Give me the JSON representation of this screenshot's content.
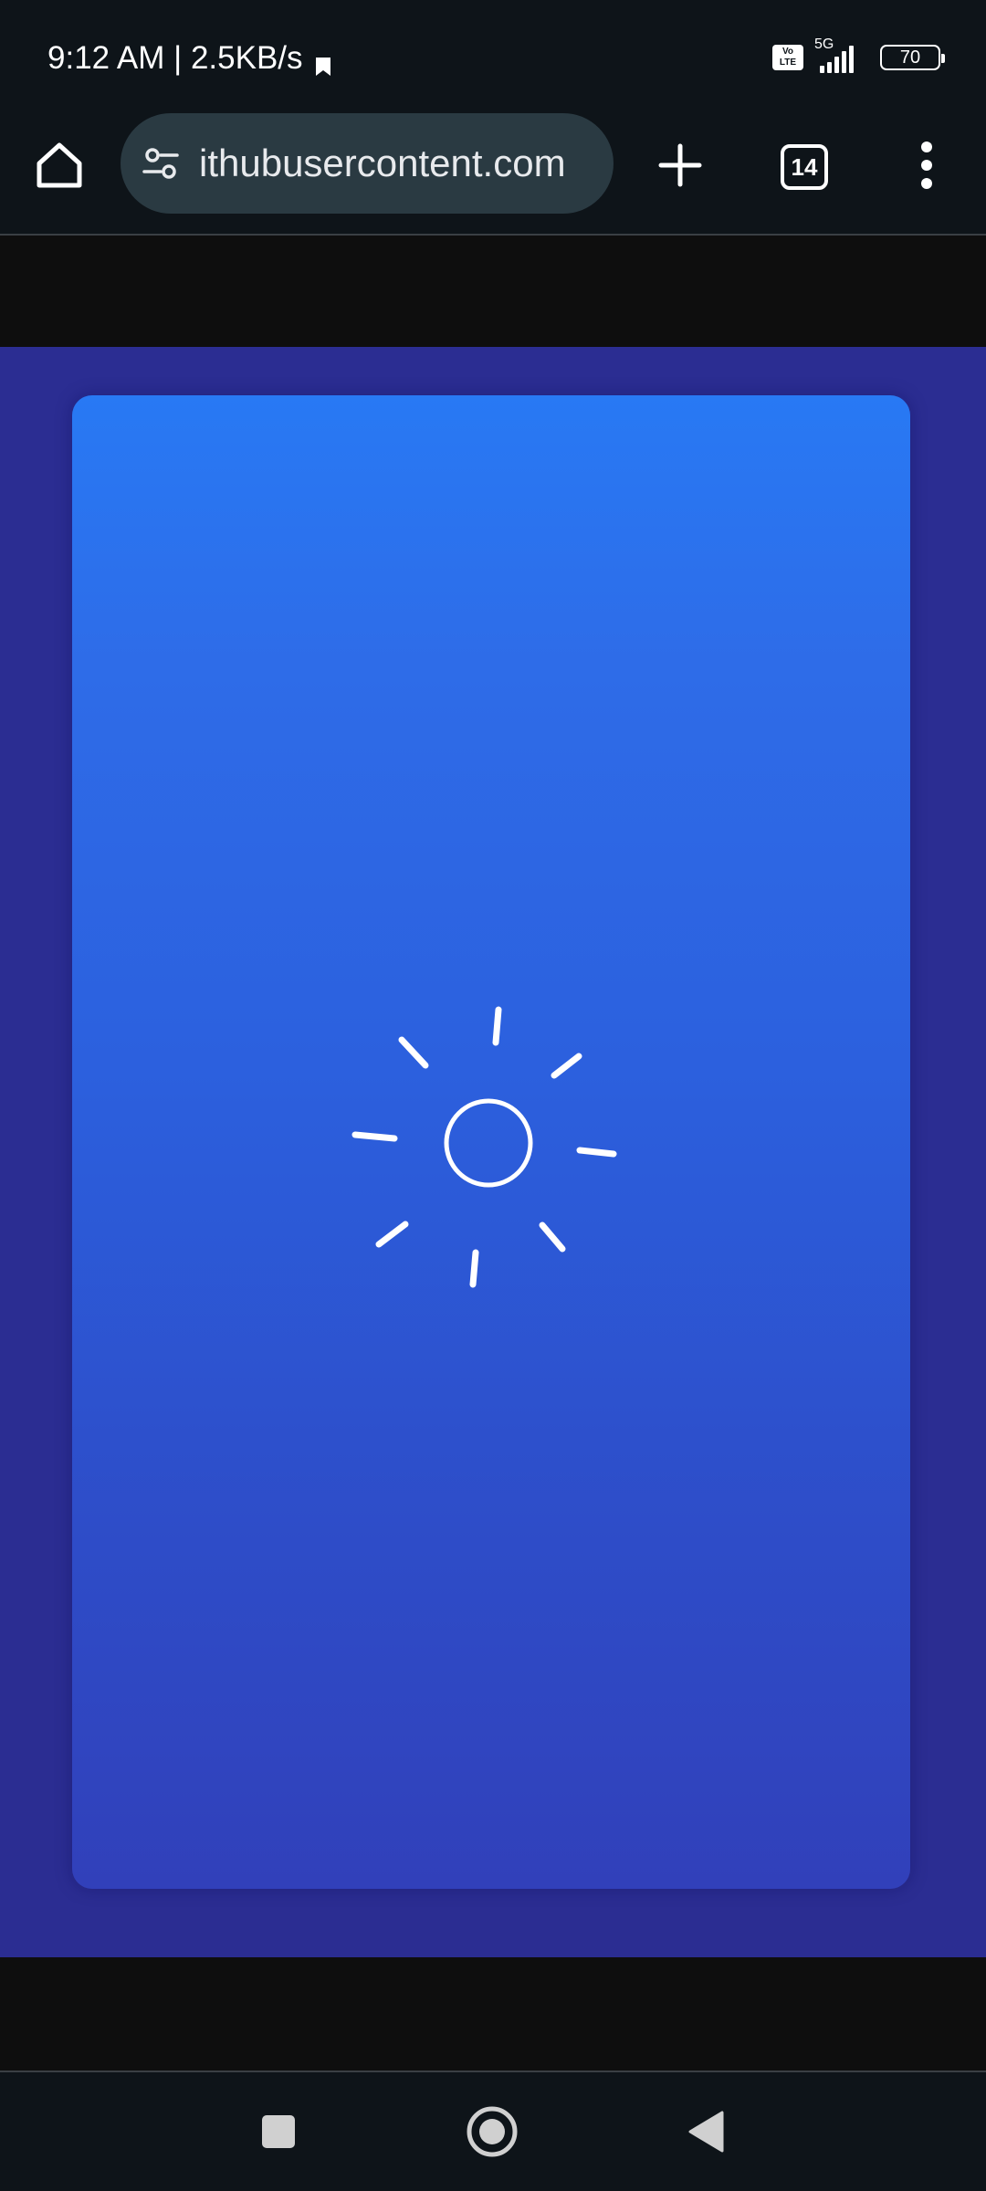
{
  "status_bar": {
    "time_speed": "9:12 AM | 2.5KB/s",
    "volte_top": "Vo",
    "volte_bottom": "LTE",
    "network": "5G",
    "battery": "70"
  },
  "toolbar": {
    "url": "ithubusercontent.com",
    "tab_count": "14",
    "icons": [
      "home-icon",
      "site-settings-icon",
      "plus-icon",
      "tab-switcher-icon",
      "more-vert-icon"
    ]
  },
  "page": {
    "card_icon": "sun-icon",
    "colors": {
      "page_background": "#2b2d92",
      "card_top": "#2879f4",
      "card_bottom": "#3140ba",
      "icon_stroke": "#ffffff"
    }
  },
  "nav_bar": {
    "icons": [
      "recent-apps-icon",
      "home-circle-icon",
      "back-icon"
    ]
  }
}
